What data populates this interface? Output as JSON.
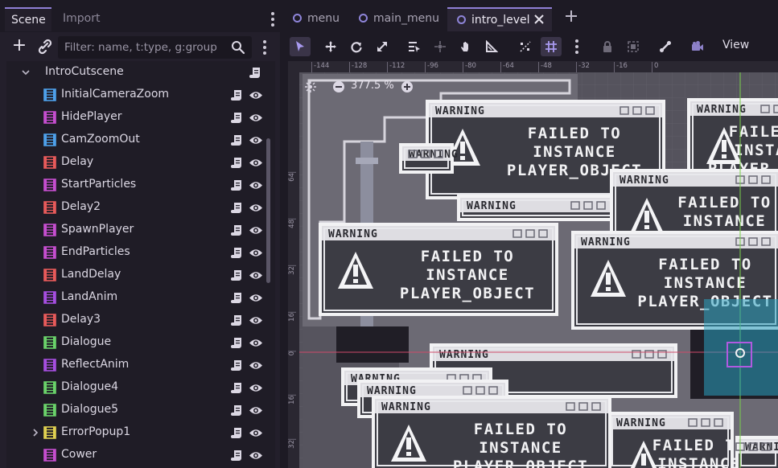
{
  "dock": {
    "tabs": [
      {
        "label": "Scene"
      },
      {
        "label": "Import"
      }
    ],
    "filter_placeholder": "Filter: name, t:type, g:group",
    "root": {
      "label": "IntroCutscene"
    },
    "nodes": [
      {
        "label": "InitialCameraZoom",
        "color": "#4ea0ea"
      },
      {
        "label": "HidePlayer",
        "color": "#c64ecf"
      },
      {
        "label": "CamZoomOut",
        "color": "#4ea0ea"
      },
      {
        "label": "Delay",
        "color": "#e85a5a"
      },
      {
        "label": "StartParticles",
        "color": "#c64ecf"
      },
      {
        "label": "Delay2",
        "color": "#e85a5a"
      },
      {
        "label": "SpawnPlayer",
        "color": "#c64ecf"
      },
      {
        "label": "EndParticles",
        "color": "#c64ecf"
      },
      {
        "label": "LandDelay",
        "color": "#e85a5a"
      },
      {
        "label": "LandAnim",
        "color": "#a64ee0"
      },
      {
        "label": "Delay3",
        "color": "#e85a5a"
      },
      {
        "label": "Dialogue",
        "color": "#6ad26a"
      },
      {
        "label": "ReflectAnim",
        "color": "#a64ee0"
      },
      {
        "label": "Dialogue4",
        "color": "#6ad26a"
      },
      {
        "label": "Dialogue5",
        "color": "#6ad26a"
      },
      {
        "label": "ErrorPopup1",
        "color": "#e0d050",
        "collapsed": true
      },
      {
        "label": "Cower",
        "color": "#c64ecf"
      }
    ]
  },
  "editor": {
    "tabs": [
      {
        "label": "menu"
      },
      {
        "label": "main_menu"
      },
      {
        "label": "intro_level"
      }
    ],
    "view_label": "View",
    "zoom_label": "377.5 %",
    "ruler_top": [
      "-144",
      "-128",
      "-112",
      "-96",
      "-80",
      "-64",
      "-48",
      "-32",
      "-16",
      "0"
    ],
    "ruler_left": [
      "64",
      "48",
      "32",
      "16",
      "0",
      "16",
      "32"
    ],
    "popup_title": "WARNING",
    "popup_lines": [
      "FAILED TO",
      "INSTANCE",
      "PLAYER_OBJECT"
    ],
    "popup_icon": "warning-triangle-icon",
    "accent": "#8f7fd6"
  }
}
